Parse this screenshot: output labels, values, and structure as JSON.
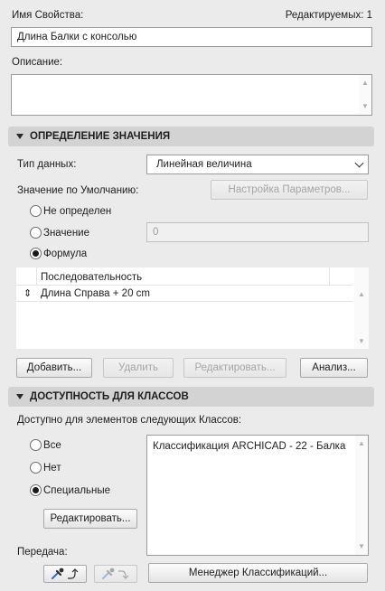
{
  "header": {
    "property_name_label": "Имя Свойства:",
    "editable_count": "Редактируемых: 1",
    "property_name_value": "Длина Балки с консолью",
    "description_label": "Описание:",
    "description_value": ""
  },
  "value_definition": {
    "section_title": "ОПРЕДЕЛЕНИЕ ЗНАЧЕНИЯ",
    "data_type_label": "Тип данных:",
    "data_type_value": "Линейная величина",
    "default_value_label": "Значение по Умолчанию:",
    "setup_params_button": "Настройка Параметров...",
    "radio_undefined": "Не определен",
    "radio_value": "Значение",
    "value_input": "0",
    "radio_formula": "Формула",
    "selected_mode": "Формула",
    "sequence_header": "Последовательность",
    "sequence_rows": [
      "Длина Справа + 20 cm"
    ],
    "add_button": "Добавить...",
    "delete_button": "Удалить",
    "edit_button": "Редактировать...",
    "analysis_button": "Анализ..."
  },
  "class_availability": {
    "section_title": "ДОСТУПНОСТЬ ДЛЯ КЛАССОВ",
    "available_label": "Доступно для элементов следующих Классов:",
    "radio_all": "Все",
    "radio_none": "Нет",
    "radio_special": "Специальные",
    "selected_mode": "Специальные",
    "edit_button": "Редактировать...",
    "classes_list": [
      "Классификация ARCHICAD - 22 - Балка"
    ],
    "transfer_label": "Передача:",
    "classification_manager_button": "Менеджер Классификаций..."
  },
  "icons": {
    "section_toggle": "triangle-down-icon",
    "sort_handle": "up-down-arrows-icon",
    "pick_up": "eyedropper-pick-icon",
    "inject": "eyedropper-inject-icon"
  },
  "colors": {
    "background": "#ebebeb",
    "section_header": "#d3d3d3",
    "field_background": "#ffffff",
    "disabled_text": "#a6a6a6"
  }
}
